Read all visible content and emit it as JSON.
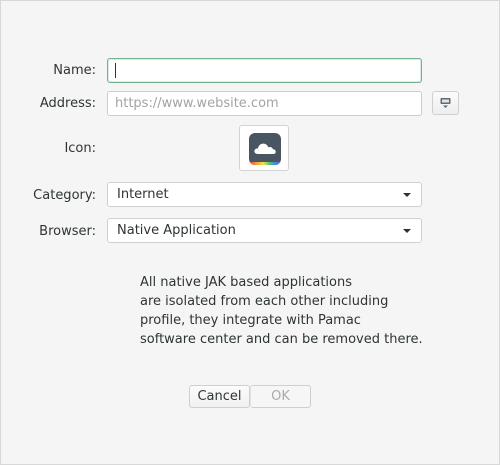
{
  "form": {
    "name_label": "Name:",
    "name_value": "",
    "address_label": "Address:",
    "address_placeholder": "https://www.website.com",
    "icon_label": "Icon:",
    "category_label": "Category:",
    "category_value": "Internet",
    "browser_label": "Browser:",
    "browser_value": "Native Application"
  },
  "info": {
    "lines": [
      "All native JAK based applications",
      "are isolated from each other including",
      "profile, they integrate with Pamac",
      "software center and can be removed there."
    ]
  },
  "buttons": {
    "cancel_label": "Cancel",
    "ok_label": "OK"
  },
  "icons": {
    "fetch_icon": "monitor-download-icon",
    "app_icon": "cloud-icon"
  },
  "colors": {
    "focus_border": "#6fb48f",
    "app_icon_bg": "#4a5563"
  }
}
